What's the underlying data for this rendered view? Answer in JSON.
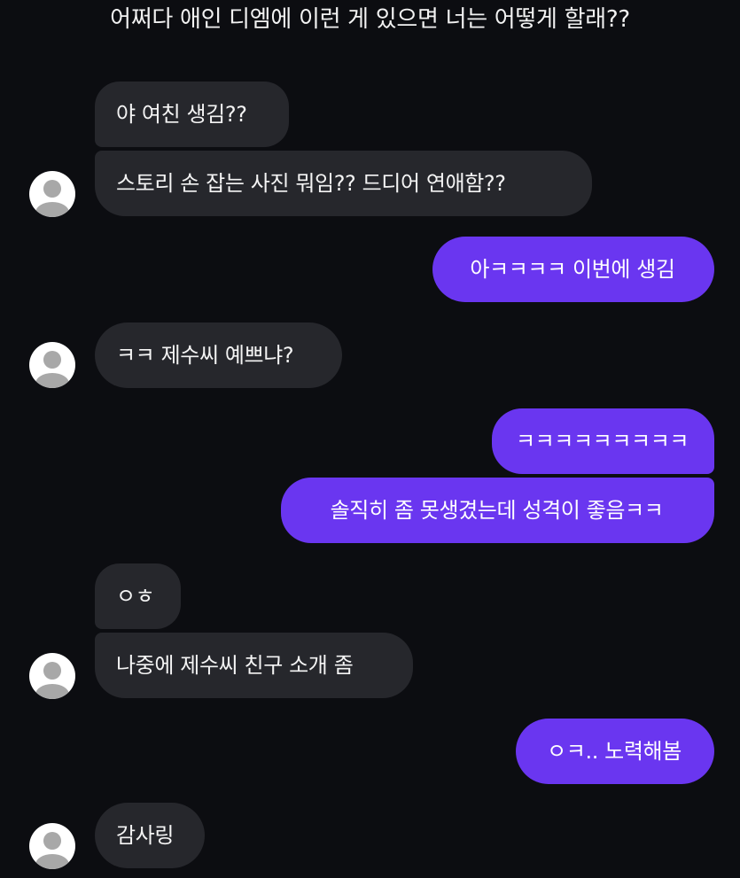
{
  "header": {
    "title": "어쩌다 애인 디엠에 이런 게 있으면 너는 어떻게 할래??"
  },
  "messages": [
    {
      "text": "야 여친 생김??"
    },
    {
      "text": "스토리 손 잡는 사진 뭐임?? 드디어 연애함??"
    },
    {
      "text": "아ㅋㅋㅋㅋ 이번에 생김"
    },
    {
      "text": "ㅋㅋ 제수씨 예쁘냐?"
    },
    {
      "text": "ㅋㅋㅋㅋㅋㅋㅋㅋㅋ"
    },
    {
      "text": "솔직히 좀 못생겼는데 성격이 좋음ㅋㅋ"
    },
    {
      "text": "ㅇㅎ"
    },
    {
      "text": "나중에 제수씨 친구 소개 좀"
    },
    {
      "text": "ㅇㅋ.. 노력해봄"
    },
    {
      "text": "감사링"
    }
  ],
  "colors": {
    "background": "#0c0d11",
    "incoming_bubble": "#26272c",
    "outgoing_bubble": "#6a36f0",
    "avatar_fill": "#ffffff",
    "avatar_figure": "#a8a8a8"
  },
  "icons": {
    "avatar": "default-person-avatar-icon"
  }
}
